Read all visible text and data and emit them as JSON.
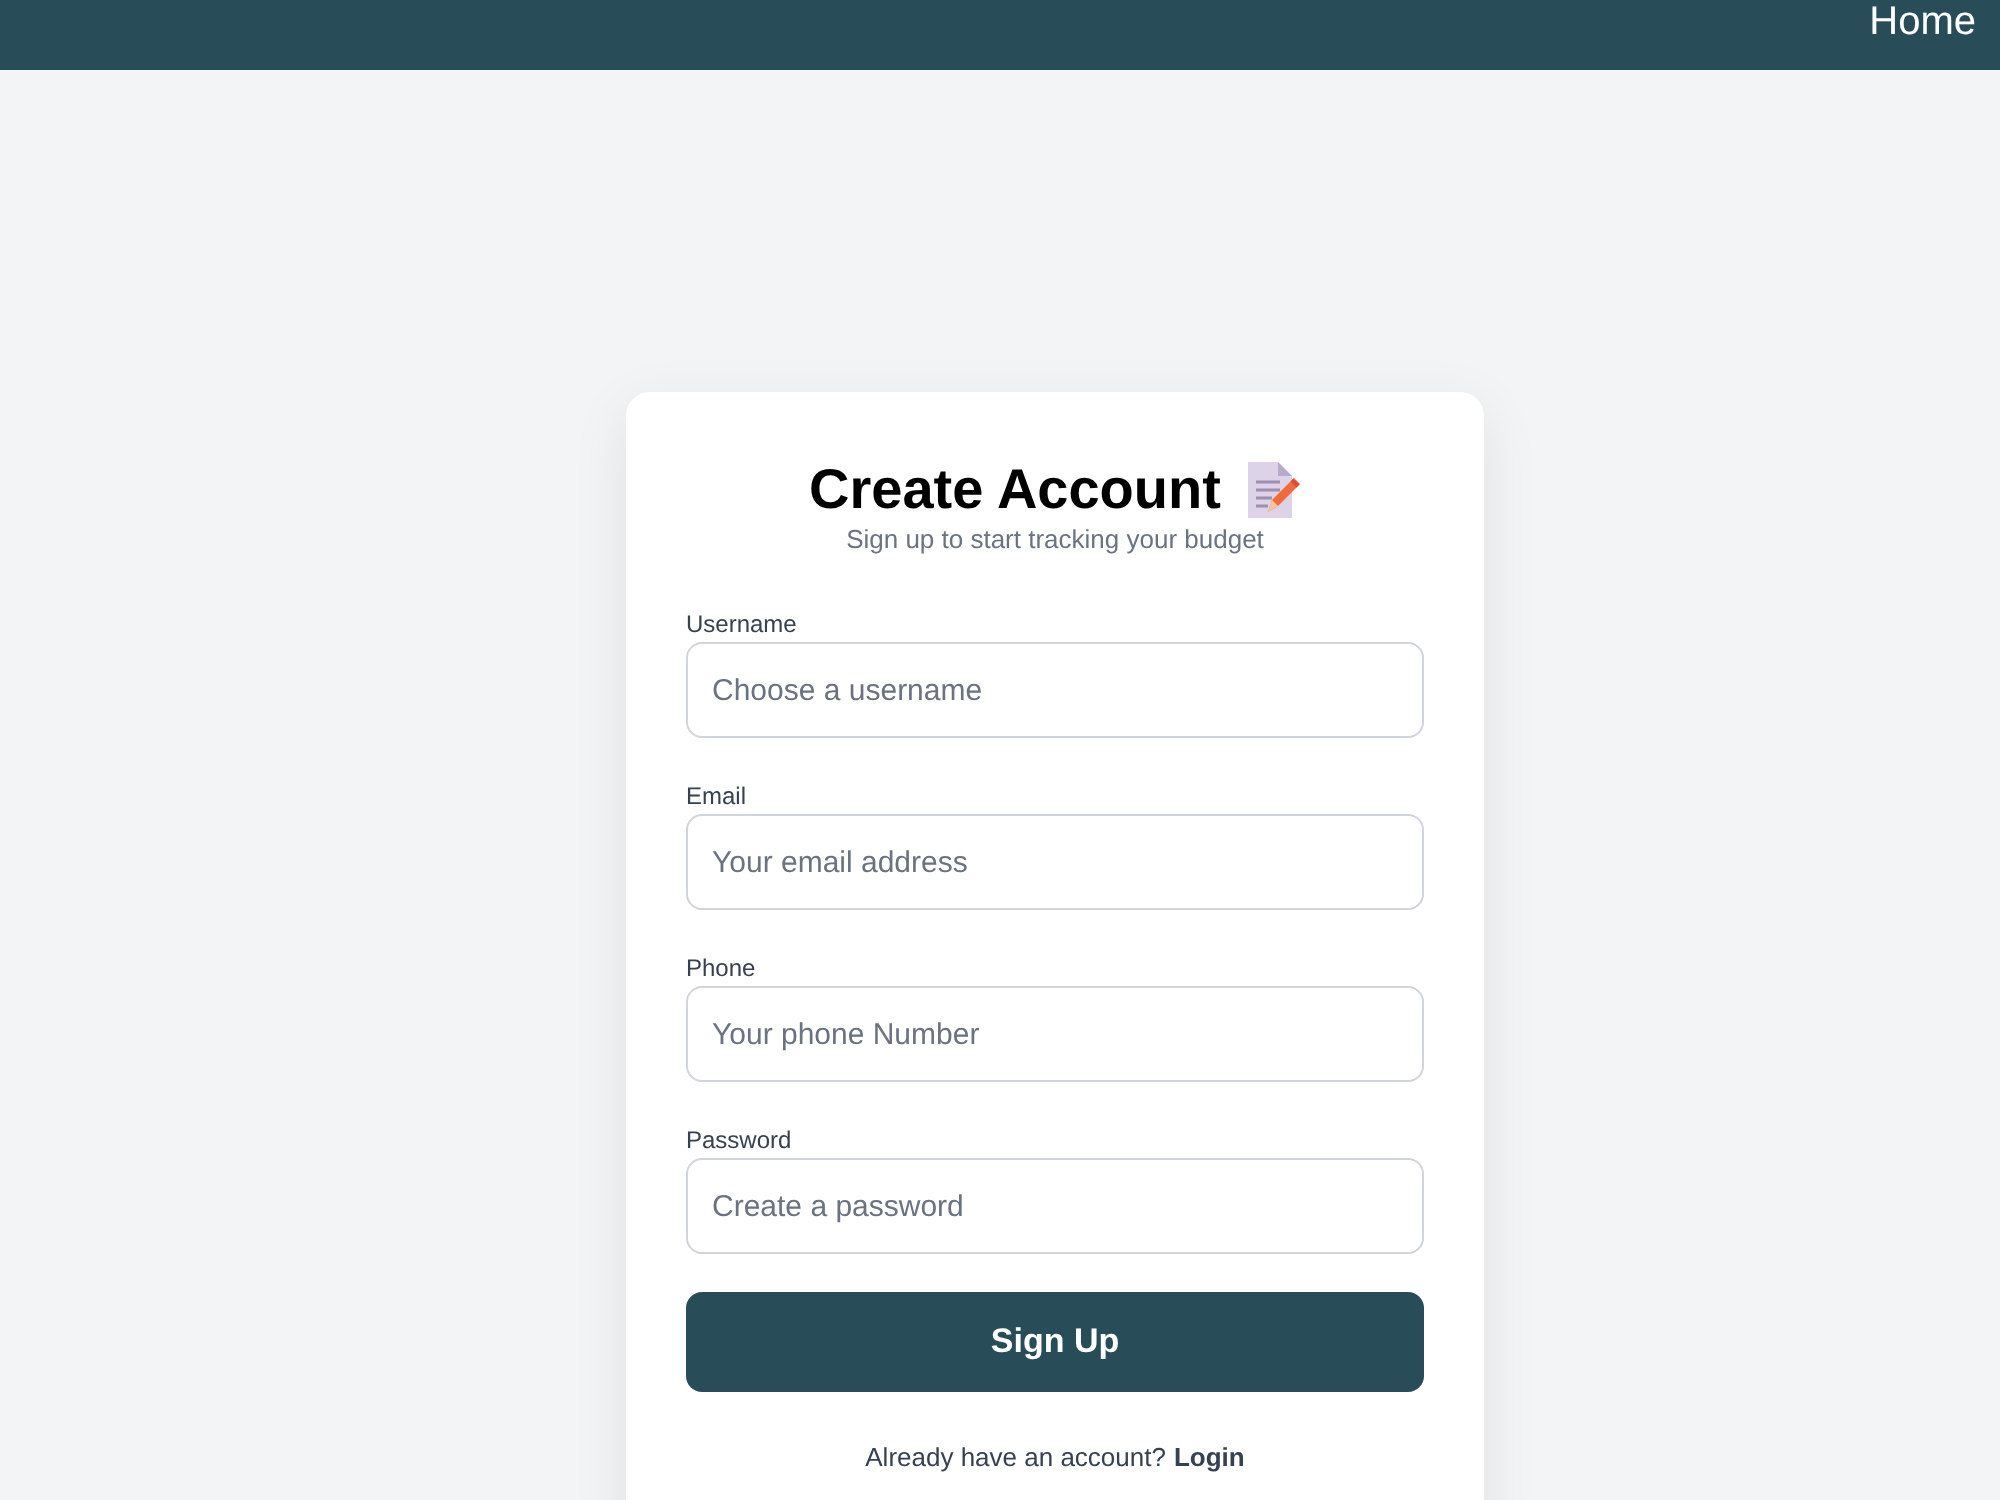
{
  "header": {
    "nav_link": "Home"
  },
  "card": {
    "title": "Create Account",
    "subtitle": "Sign up to start tracking your budget"
  },
  "fields": [
    {
      "label": "Username",
      "placeholder": "Choose a username"
    },
    {
      "label": "Email",
      "placeholder": "Your email address"
    },
    {
      "label": "Phone",
      "placeholder": "Your phone Number"
    },
    {
      "label": "Password",
      "placeholder": "Create a password"
    }
  ],
  "submit_button": "Sign Up",
  "footer": {
    "prompt": "Already have an account?",
    "link": "Login"
  }
}
